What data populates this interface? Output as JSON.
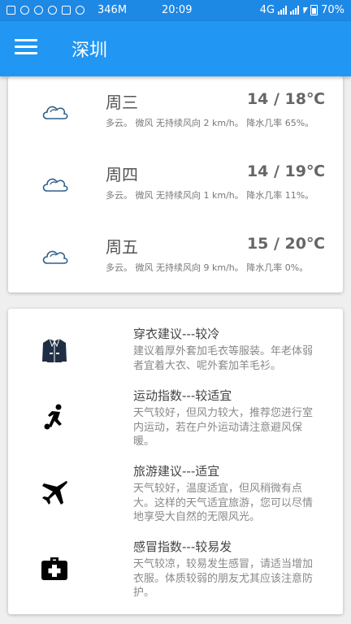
{
  "status_bar": {
    "network_speed": "346M",
    "time": "20:09",
    "network_type": "4G",
    "battery": "70%"
  },
  "app_bar": {
    "title": "深圳",
    "menu_icon": "hamburger-menu-icon"
  },
  "forecast": [
    {
      "day": "周三",
      "temp": "14 / 18℃",
      "desc": "多云。 微风 无持续风向 2 km/h。 降水几率 65%。",
      "icon": "cloud-icon"
    },
    {
      "day": "周四",
      "temp": "14 / 19℃",
      "desc": "多云。 微风 无持续风向 1 km/h。 降水几率 11%。",
      "icon": "cloud-icon"
    },
    {
      "day": "周五",
      "temp": "15 / 20℃",
      "desc": "多云。 微风 无持续风向 9 km/h。 降水几率 0%。",
      "icon": "cloud-icon"
    }
  ],
  "advice": [
    {
      "title": "穿衣建议---较冷",
      "text": "建议着厚外套加毛衣等服装。年老体弱者宜着大衣、呢外套加羊毛衫。",
      "icon": "jacket-icon"
    },
    {
      "title": "运动指数---较适宜",
      "text": "天气较好，但风力较大，推荐您进行室内运动，若在户外运动请注意避风保暖。",
      "icon": "soccer-player-icon"
    },
    {
      "title": "旅游建议---适宜",
      "text": "天气较好，温度适宜，但风稍微有点大。这样的天气适宜旅游，您可以尽情地享受大自然的无限风光。",
      "icon": "airplane-icon"
    },
    {
      "title": "感冒指数---较易发",
      "text": "天气较凉，较易发生感冒，请适当增加衣服。体质较弱的朋友尤其应该注意防护。",
      "icon": "medical-kit-icon"
    }
  ],
  "colors": {
    "primary": "#2196f3",
    "status_bar": "#1e88e5",
    "cloud_stroke": "#2e5f8a"
  }
}
